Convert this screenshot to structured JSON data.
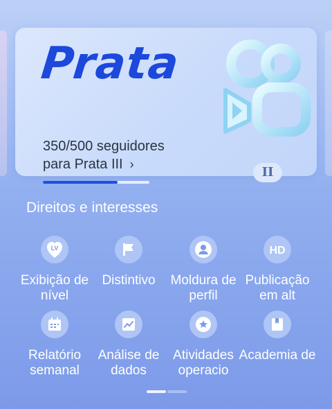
{
  "tier": {
    "name": "Prata",
    "progress_line1": "350/500 seguidores",
    "progress_line2": "para Prata III",
    "chevron": "›",
    "progress_fraction": 0.7,
    "level_badge": "II"
  },
  "benefits": {
    "title": "Direitos e interesses",
    "items": [
      {
        "label": "Exibição de nível",
        "icon": "lv-badge-icon",
        "icon_text": "LV"
      },
      {
        "label": "Distintivo",
        "icon": "flag-icon"
      },
      {
        "label": "Moldura de perfil",
        "icon": "avatar-frame-icon"
      },
      {
        "label": "Publicação em alt",
        "icon": "hd-icon",
        "icon_text": "HD"
      },
      {
        "label": "Relatório semanal",
        "icon": "calendar-icon"
      },
      {
        "label": "Análise de dados",
        "icon": "trend-chart-icon"
      },
      {
        "label": "Atividades operacio",
        "icon": "star-badge-icon"
      },
      {
        "label": "Academia de",
        "icon": "book-icon"
      }
    ]
  },
  "colors": {
    "accent": "#1d48dc",
    "background_top": "#bcd1f7",
    "background_bottom": "#7c9ae9"
  }
}
